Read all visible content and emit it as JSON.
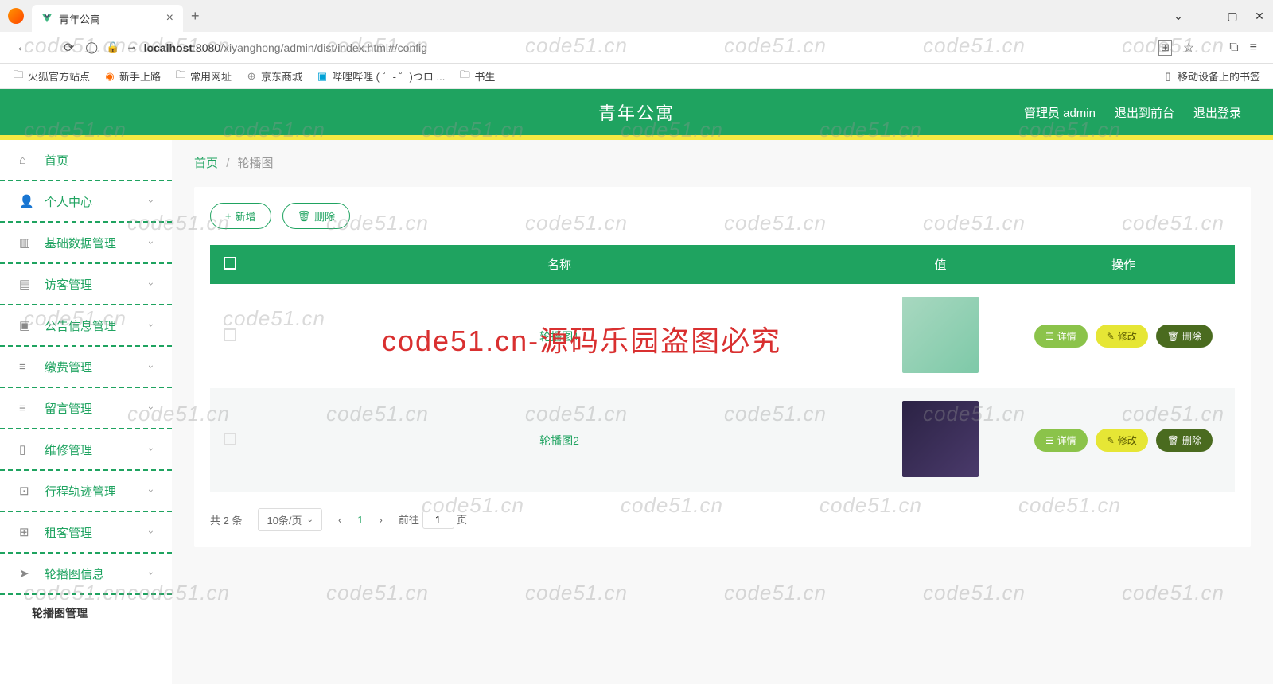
{
  "browser": {
    "tab_title": "青年公寓",
    "url_host": "localhost",
    "url_port": ":8080",
    "url_path": "/xiyanghong/admin/dist/index.html#/config",
    "bookmarks": [
      "火狐官方站点",
      "新手上路",
      "常用网址",
      "京东商城",
      "哔哩哔哩 ( ゜- ゜)つロ ...",
      "书生"
    ],
    "bookmark_right": "移动设备上的书签"
  },
  "header": {
    "title": "青年公寓",
    "admin_label": "管理员 admin",
    "exit_front": "退出到前台",
    "logout": "退出登录"
  },
  "sidebar": {
    "items": [
      {
        "label": "首页"
      },
      {
        "label": "个人中心"
      },
      {
        "label": "基础数据管理"
      },
      {
        "label": "访客管理"
      },
      {
        "label": "公告信息管理"
      },
      {
        "label": "缴费管理"
      },
      {
        "label": "留言管理"
      },
      {
        "label": "维修管理"
      },
      {
        "label": "行程轨迹管理"
      },
      {
        "label": "租客管理"
      },
      {
        "label": "轮播图信息"
      }
    ],
    "sub_active": "轮播图管理"
  },
  "breadcrumb": {
    "home": "首页",
    "current": "轮播图"
  },
  "actions": {
    "add": "新增",
    "delete": "删除"
  },
  "table": {
    "headers": [
      "",
      "名称",
      "值",
      "操作"
    ],
    "rows": [
      {
        "name": "轮播图1"
      },
      {
        "name": "轮播图2"
      }
    ],
    "btn_detail": "详情",
    "btn_edit": "修改",
    "btn_delete": "删除"
  },
  "pagination": {
    "total": "共 2 条",
    "per_page": "10条/页",
    "current": "1",
    "goto_prefix": "前往",
    "goto_val": "1",
    "goto_suffix": "页"
  },
  "watermark": "code51.cn",
  "watermark_red": "code51.cn-源码乐园盗图必究"
}
